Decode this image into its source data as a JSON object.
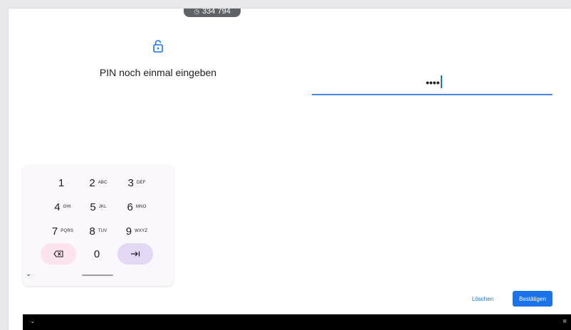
{
  "status": {
    "timer_text": "334 794",
    "timer_icon": "clock-icon"
  },
  "lock": {
    "icon": "lock-icon",
    "color": "#1a73e8"
  },
  "prompt": {
    "text": "PIN noch einmal eingeben"
  },
  "pin_input": {
    "value": "••••",
    "underline_color": "#4a86e8"
  },
  "keyboard": {
    "keys": [
      {
        "digit": "1",
        "letters": ""
      },
      {
        "digit": "2",
        "letters": "ABC"
      },
      {
        "digit": "3",
        "letters": "DEF"
      },
      {
        "digit": "4",
        "letters": "GHI"
      },
      {
        "digit": "5",
        "letters": "JKL"
      },
      {
        "digit": "6",
        "letters": "MNO"
      },
      {
        "digit": "7",
        "letters": "PQRS"
      },
      {
        "digit": "8",
        "letters": "TUV"
      },
      {
        "digit": "9",
        "letters": "WXYZ"
      },
      {
        "digit": "0",
        "letters": ""
      }
    ],
    "delete_icon": "backspace-icon",
    "next_icon": "tab-next-icon",
    "hide_icon": "chevron-down-icon",
    "delete_color": "#fde2ef",
    "next_color": "#e3d8f6"
  },
  "actions": {
    "clear_label": "Löschen",
    "confirm_label": "Bestätigen",
    "accent": "#1a73e8"
  },
  "nav": {
    "back_icon": "chevron-down-icon",
    "keyboard_icon": "keyboard-icon"
  }
}
